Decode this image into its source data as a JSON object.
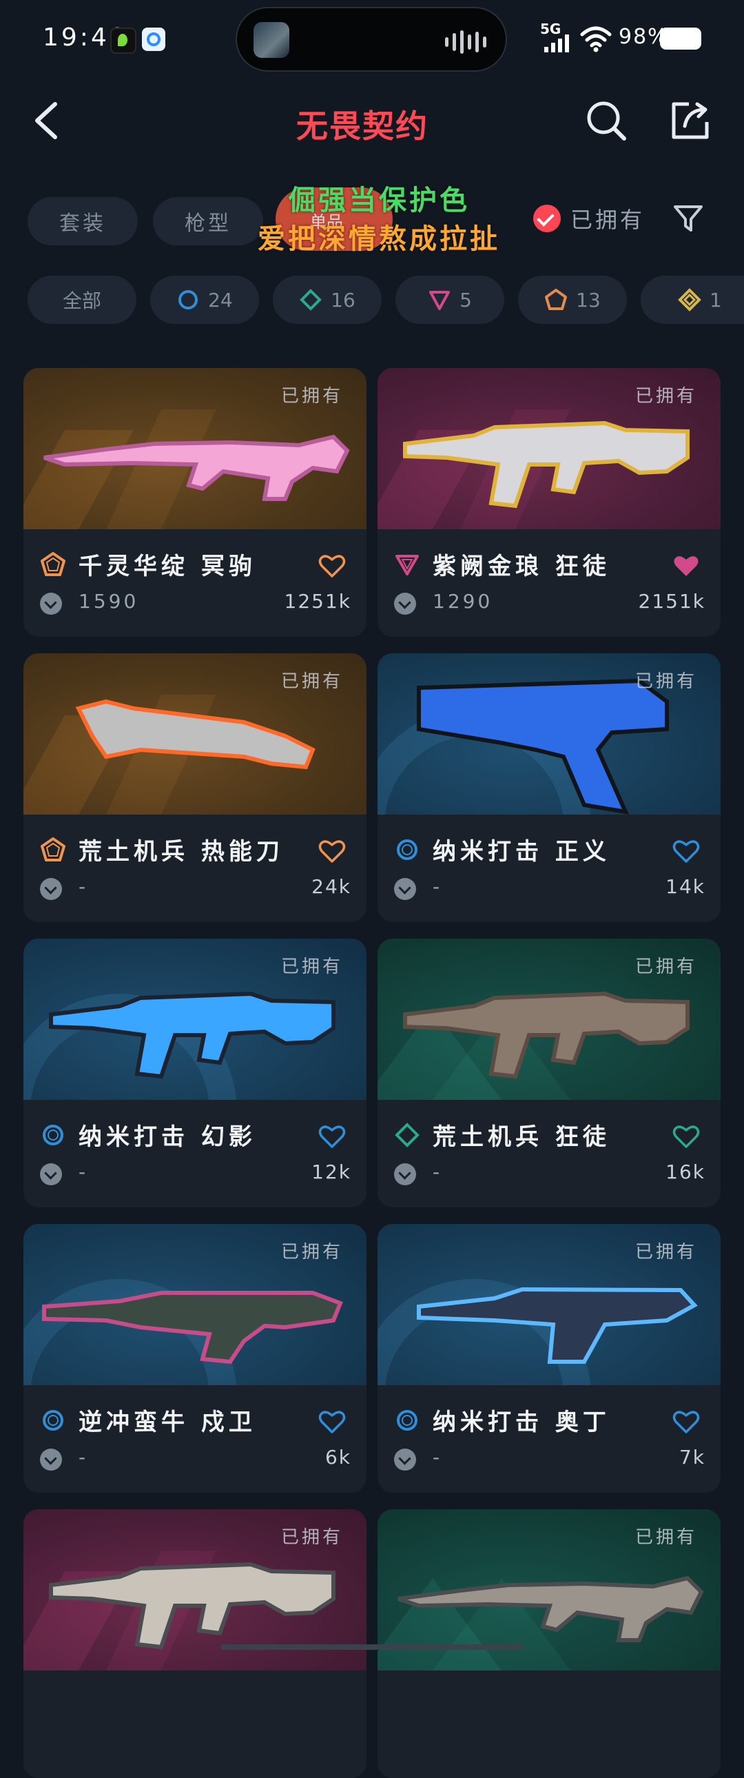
{
  "status_bar": {
    "time": "19:40",
    "network": "5G",
    "battery": "98%"
  },
  "header": {
    "title": "无畏契约"
  },
  "filters": {
    "category_tabs": [
      "套装",
      "枪型"
    ],
    "overlay_line1": "倔强当保护色",
    "overlay_line2": "爱把深情熬成拉扯",
    "highlight_label": "单品",
    "owned_toggle_label": "已拥有",
    "tiers": [
      {
        "label": "全部",
        "count": ""
      },
      {
        "tier": "select",
        "count": "24",
        "color": "#2f8fd8"
      },
      {
        "tier": "deluxe",
        "count": "16",
        "color": "#2aa98d"
      },
      {
        "tier": "premium",
        "count": "5",
        "color": "#d14a8b"
      },
      {
        "tier": "exclusive",
        "count": "13",
        "color": "#e88a4a"
      },
      {
        "tier": "ultra",
        "count": "1",
        "color": "#d8b84a"
      }
    ]
  },
  "skins": [
    {
      "name": "千灵华绽 冥驹",
      "owned": "已拥有",
      "price": "1590",
      "likes": "1251k",
      "tier_color": "#f0944e",
      "liked": false,
      "bg": "orange"
    },
    {
      "name": "紫阙金琅 狂徒",
      "owned": "已拥有",
      "price": "1290",
      "likes": "2151k",
      "tier_color": "#d14a8b",
      "liked": true,
      "bg": "purple"
    },
    {
      "name": "荒土机兵 热能刀",
      "owned": "已拥有",
      "price": "-",
      "likes": "24k",
      "tier_color": "#f0944e",
      "liked": false,
      "bg": "orange"
    },
    {
      "name": "纳米打击 正义",
      "owned": "已拥有",
      "price": "-",
      "likes": "14k",
      "tier_color": "#2f8fd8",
      "liked": false,
      "bg": "blue"
    },
    {
      "name": "纳米打击 幻影",
      "owned": "已拥有",
      "price": "-",
      "likes": "12k",
      "tier_color": "#2f8fd8",
      "liked": false,
      "bg": "blue"
    },
    {
      "name": "荒土机兵 狂徒",
      "owned": "已拥有",
      "price": "-",
      "likes": "16k",
      "tier_color": "#2aa98d",
      "liked": false,
      "bg": "teal"
    },
    {
      "name": "逆冲蛮牛 戍卫",
      "owned": "已拥有",
      "price": "-",
      "likes": "6k",
      "tier_color": "#2f8fd8",
      "liked": false,
      "bg": "blue"
    },
    {
      "name": "纳米打击 奥丁",
      "owned": "已拥有",
      "price": "-",
      "likes": "7k",
      "tier_color": "#2f8fd8",
      "liked": false,
      "bg": "blue"
    },
    {
      "name": "",
      "owned": "已拥有",
      "bg": "purple"
    },
    {
      "name": "",
      "owned": "已拥有",
      "bg": "teal"
    }
  ]
}
